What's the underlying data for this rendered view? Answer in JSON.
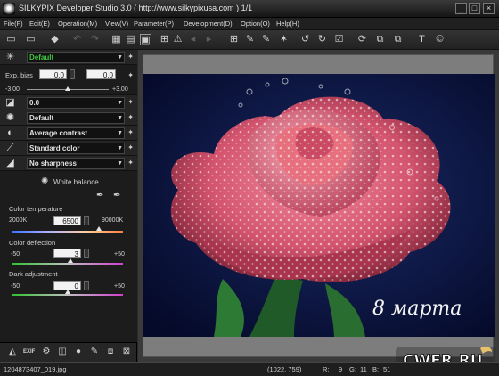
{
  "window": {
    "title": "SILKYPIX Developer Studio 3.0 ( http://www.silkypixusa.com )   1/1",
    "minimize": "_",
    "maximize": "□",
    "close": "×"
  },
  "menu": [
    "File(F)",
    "Edit(E)",
    "Operation(M)",
    "View(V)",
    "Parameter(P)",
    "Development(D)",
    "Option(O)",
    "Help(H)"
  ],
  "toolbar": {
    "icons": [
      "open-folder-icon",
      "open-recent-icon",
      "eraser-icon",
      "undo-icon",
      "redo-icon",
      "thumbnail-view-icon",
      "combined-view-icon",
      "preview-view-icon",
      "zoom-fit-icon",
      "warning-icon",
      "previous-image-icon",
      "next-image-icon",
      "grid-icon",
      "crop-icon",
      "straighten-icon",
      "tone-icon",
      "rotate-left-icon",
      "rotate-right-icon",
      "mark-icon",
      "refresh-icon",
      "batch-icon",
      "develop-icon",
      "text-icon",
      "info-icon"
    ]
  },
  "left_panel": {
    "taste": {
      "value": "Default",
      "icon": "taste-icon",
      "star": "✦"
    },
    "exposure": {
      "label": "Exp. bias",
      "value_left": "0.0",
      "value_right": "0.0",
      "min": "-3.00",
      "max": "+3.00",
      "level": 0.5
    },
    "rows": [
      {
        "icon": "exposure-curve-icon",
        "value": "0.0"
      },
      {
        "icon": "sun-icon",
        "value": "Default"
      },
      {
        "icon": "contrast-icon",
        "value": "Average contrast"
      },
      {
        "icon": "eyedropper-icon",
        "value": "Standard color"
      },
      {
        "icon": "sharpness-icon",
        "value": "No sharpness"
      }
    ],
    "white_balance": {
      "title": "White balance",
      "color_temperature": {
        "label": "Color temperature",
        "min": "2000K",
        "max": "90000K",
        "value": "6500",
        "level": 0.78
      },
      "color_deflection": {
        "label": "Color deflection",
        "min": "-50",
        "max": "+50",
        "value": "3",
        "level": 0.53
      },
      "dark_adjustment": {
        "label": "Dark adjustment",
        "min": "-50",
        "max": "+50",
        "value": "0",
        "level": 0.5
      }
    }
  },
  "bottom_icons": [
    "histogram-icon",
    "exif-icon",
    "settings-icon",
    "tone-curve-icon",
    "color-ball-icon",
    "pen-icon",
    "crop-frame-icon",
    "grid-lens-icon"
  ],
  "bottom_exif_label": "EXIF",
  "photo": {
    "caption": "8 марта"
  },
  "status": {
    "filename": "1204873407_019.jpg",
    "coords": "(1022,  759)",
    "r_label": "R:",
    "r": "9",
    "g_label": "G:",
    "g": "11",
    "b_label": "B:",
    "b": "51"
  },
  "watermark": {
    "text": "CWER.RU"
  }
}
